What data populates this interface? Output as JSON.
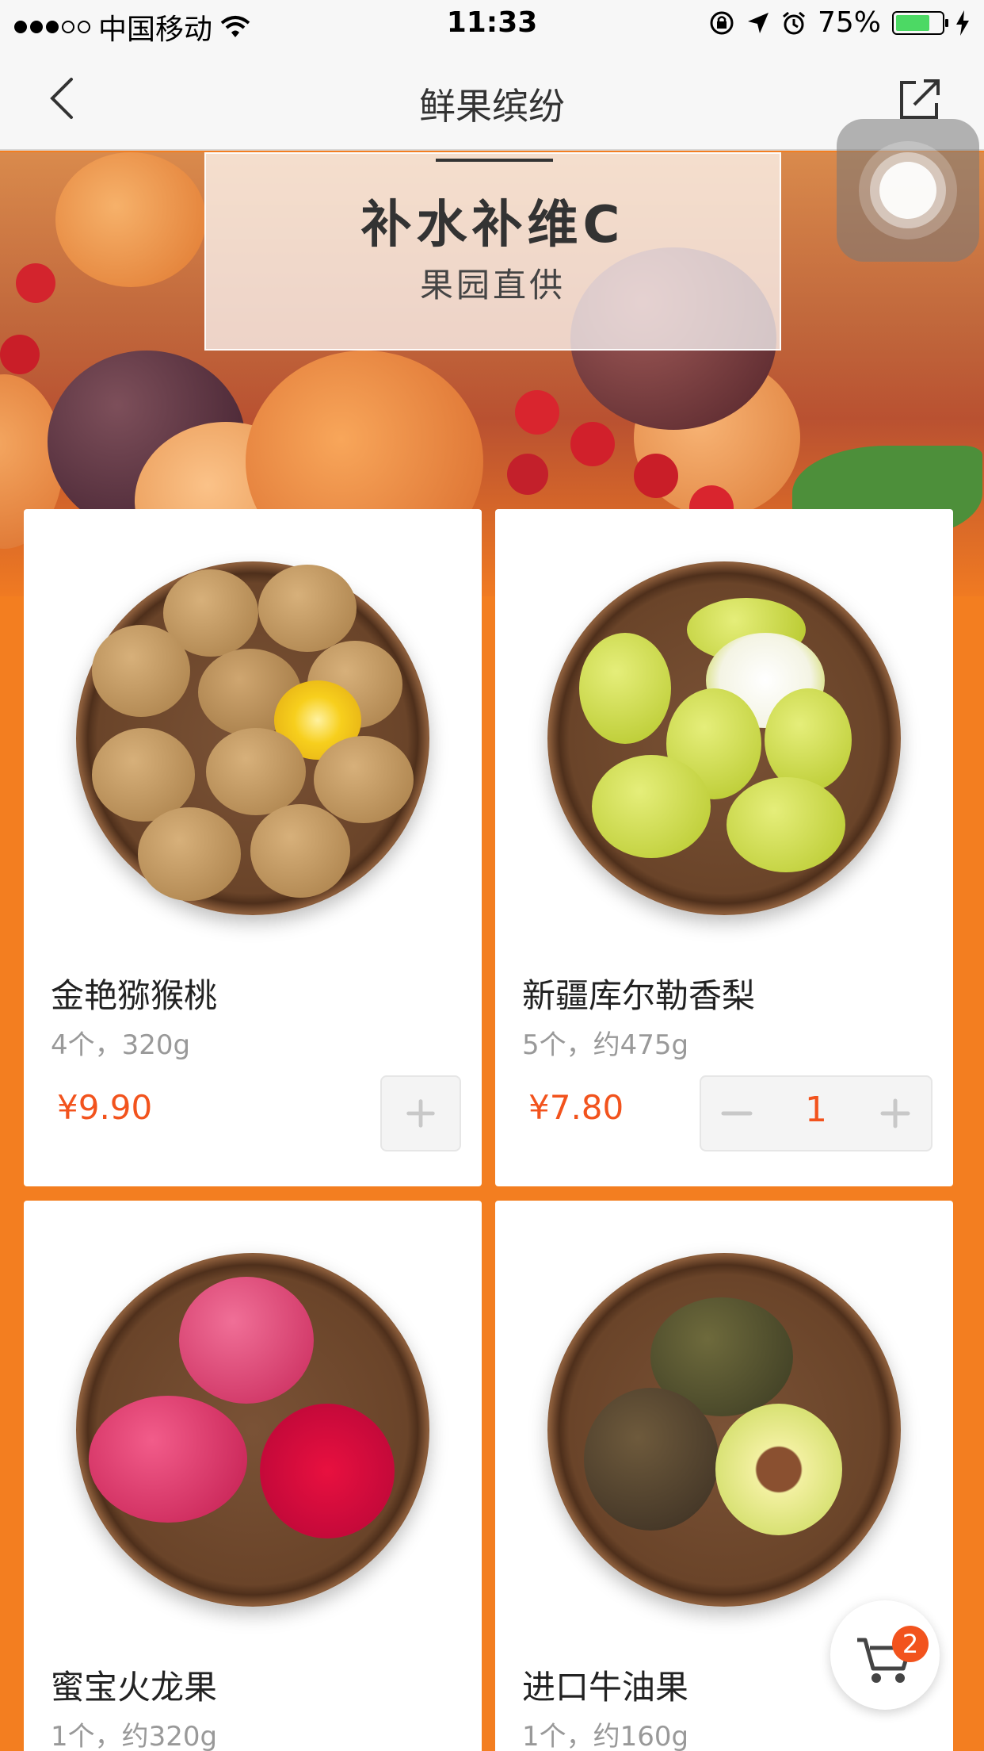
{
  "status_bar": {
    "carrier": "中国移动",
    "time": "11:33",
    "battery": "75%"
  },
  "nav": {
    "title": "鲜果缤纷",
    "back_icon": "chevron-left-icon",
    "share_icon": "share-icon"
  },
  "banner": {
    "title": "补水补维C",
    "subtitle": "果园直供"
  },
  "products": [
    {
      "name": "金艳猕猴桃",
      "spec": "4个，320g",
      "price": "¥9.90"
    },
    {
      "name": "新疆库尔勒香梨",
      "spec": "5个，约475g",
      "price": "¥7.80",
      "quantity": "1"
    },
    {
      "name": "蜜宝火龙果",
      "spec": "1个，约320g"
    },
    {
      "name": "进口牛油果",
      "spec": "1个，约160g"
    }
  ],
  "cart": {
    "count": "2",
    "icon": "cart-icon"
  },
  "colors": {
    "accent": "#f2531d",
    "background": "#f37e20"
  }
}
